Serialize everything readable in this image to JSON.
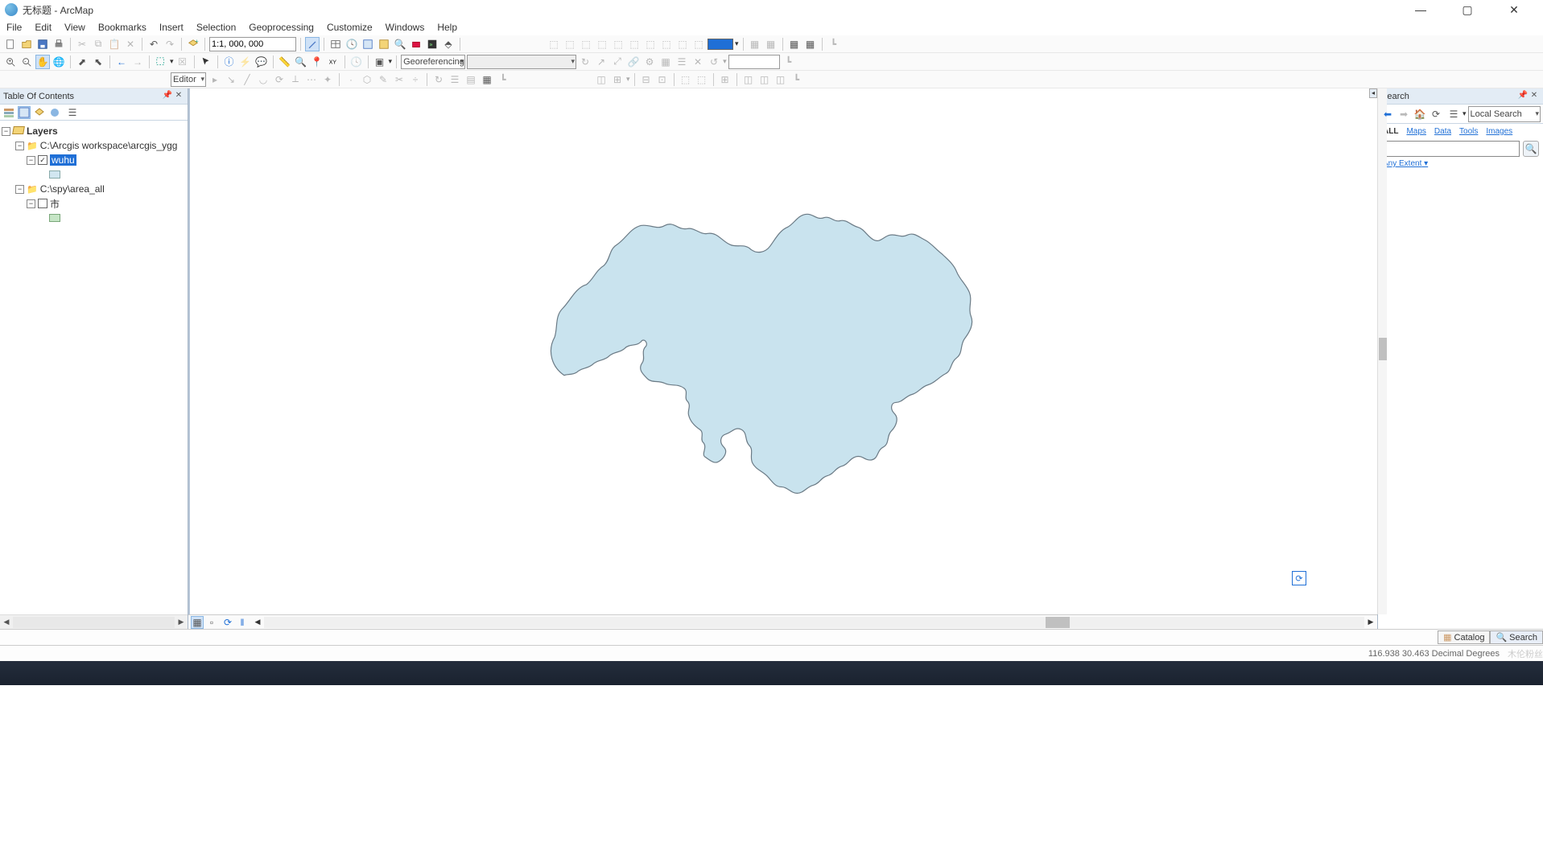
{
  "window": {
    "title": "无标题 - ArcMap"
  },
  "menu": [
    "File",
    "Edit",
    "View",
    "Bookmarks",
    "Insert",
    "Selection",
    "Geoprocessing",
    "Customize",
    "Windows",
    "Help"
  ],
  "toolbar1": {
    "scale": "1:1, 000, 000"
  },
  "toolbar3": {
    "editor_label": "Editor",
    "georef_label": "Georeferencing"
  },
  "toc": {
    "title": "Table Of Contents",
    "root": "Layers",
    "group1_path": "C:\\Arcgis workspace\\arcgis_ygg",
    "layer1_name": "wuhu",
    "layer1_checked": true,
    "layer1_fill": "#d1e6f0",
    "group2_path": "C:\\spy\\area_all",
    "layer2_name": "市",
    "layer2_checked": false,
    "layer2_fill": "#c6e5c6"
  },
  "search": {
    "title": "Search",
    "scope": "Local Search",
    "tabs": [
      "ALL",
      "Maps",
      "Data",
      "Tools",
      "Images"
    ],
    "active_tab": "ALL",
    "placeholder": "",
    "extent_label": "Any Extent"
  },
  "status": {
    "catalog_label": "Catalog",
    "search_label": "Search",
    "coords": "116.938  30.463 Decimal Degrees",
    "watermark": "木伦粉丝"
  },
  "chart_data": {
    "type": "map",
    "title": "",
    "layers": [
      {
        "name": "wuhu",
        "visible": true,
        "geometry_type": "polygon",
        "fill": "#c9e3ee",
        "stroke": "#6a7a85"
      },
      {
        "name": "市",
        "visible": false,
        "geometry_type": "polygon",
        "fill": "#c6e5c6",
        "stroke": "#7aa77a"
      }
    ],
    "coordinate_readout": {
      "x": 116.938,
      "y": 30.463,
      "units": "Decimal Degrees"
    },
    "scale": "1:1,000,000"
  }
}
